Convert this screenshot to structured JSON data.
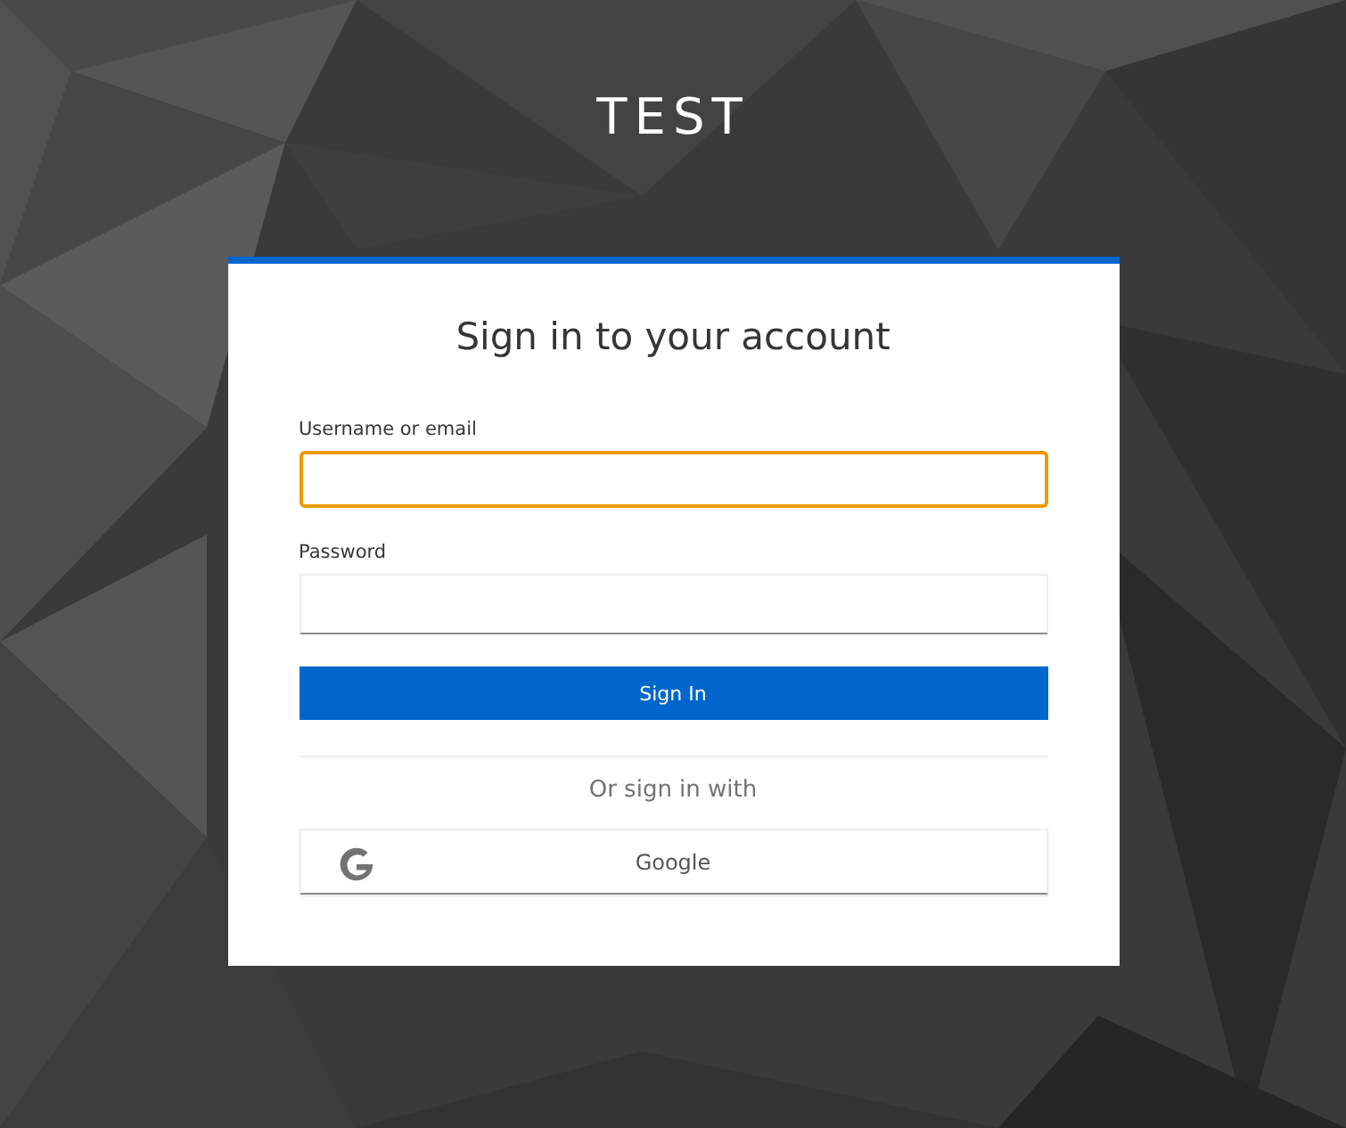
{
  "realm_title": "TEST",
  "card": {
    "heading": "Sign in to your account",
    "fields": [
      {
        "label": "Username or email",
        "focused": true
      },
      {
        "label": "Password",
        "focused": false
      }
    ],
    "submit_button": "Sign In",
    "social_heading": "Or sign in with",
    "social_providers": [
      {
        "label": "Google",
        "kind": "google"
      }
    ]
  }
}
